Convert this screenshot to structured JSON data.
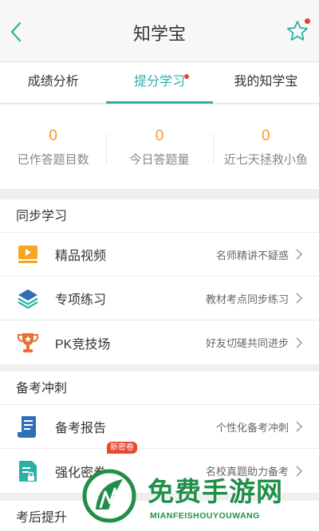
{
  "header": {
    "title": "知学宝"
  },
  "tabs": [
    {
      "label": "成绩分析"
    },
    {
      "label": "提分学习"
    },
    {
      "label": "我的知学宝"
    }
  ],
  "stats": [
    {
      "value": "0",
      "label": "已作答题目数"
    },
    {
      "value": "0",
      "label": "今日答题量"
    },
    {
      "value": "0",
      "label": "近七天拯救小鱼"
    }
  ],
  "sections": {
    "sync": {
      "title": "同步学习",
      "items": [
        {
          "label": "精品视频",
          "desc": "名师精讲不疑惑",
          "icon": "video-icon"
        },
        {
          "label": "专项练习",
          "desc": "教材考点同步练习",
          "icon": "layers-icon"
        },
        {
          "label": "PK竞技场",
          "desc": "好友切磋共同进步",
          "icon": "trophy-icon"
        }
      ]
    },
    "exam": {
      "title": "备考冲刺",
      "items": [
        {
          "label": "备考报告",
          "desc": "个性化备考冲刺",
          "icon": "report-icon"
        },
        {
          "label": "强化密卷",
          "desc": "名校真题助力备考",
          "icon": "lock-paper-icon",
          "badge": "新密卷"
        }
      ]
    },
    "post": {
      "title": "考后提升"
    }
  },
  "watermark": {
    "text": "免费手游网",
    "sub": "MIANFEISHOUYOUWANG"
  },
  "colors": {
    "accent": "#2bb0a8",
    "number": "#f39a2a",
    "dot": "#e8472c"
  }
}
